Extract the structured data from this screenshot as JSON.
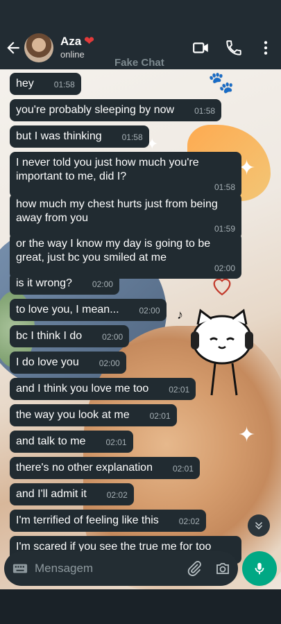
{
  "header": {
    "contact_name": "Aza",
    "contact_emoji": "❤",
    "status": "online",
    "watermark": "Fake Chat"
  },
  "messages": [
    {
      "text": "hey",
      "time": "01:58"
    },
    {
      "text": "you're probably sleeping by now",
      "time": "01:58"
    },
    {
      "text": "but I was thinking",
      "time": "01:58"
    },
    {
      "text": "I never told you just how much you're important to me, did I?",
      "time": "01:58"
    },
    {
      "text": "how much my chest hurts just from being away from you",
      "time": "01:59"
    },
    {
      "text": "or the way I know my day is going to be great, just bc you smiled at me",
      "time": "02:00"
    },
    {
      "text": "is it wrong?",
      "time": "02:00"
    },
    {
      "text": "to love you, I mean...",
      "time": "02:00"
    },
    {
      "text": "bc I think I do",
      "time": "02:00"
    },
    {
      "text": "I do love you",
      "time": "02:00"
    },
    {
      "text": "and I think you love me too",
      "time": "02:01"
    },
    {
      "text": "the way you look at me",
      "time": "02:01"
    },
    {
      "text": "and talk to me",
      "time": "02:01"
    },
    {
      "text": "there's no other explanation",
      "time": "02:01"
    },
    {
      "text": "and I'll admit it",
      "time": "02:02"
    },
    {
      "text": "I'm terrified of feeling like this",
      "time": "02:02"
    },
    {
      "text": "I'm scared if you see the true me for too",
      "time": ""
    }
  ],
  "composer": {
    "placeholder": "Mensagem"
  },
  "icons": {
    "back": "arrow-left-icon",
    "video": "video-camera-icon",
    "call": "phone-icon",
    "menu": "more-vertical-icon",
    "keyboard": "keyboard-icon",
    "attach": "paperclip-icon",
    "camera": "camera-icon",
    "mic": "microphone-icon",
    "scroll": "chevron-double-down-icon"
  },
  "colors": {
    "header_bg": "#222c33",
    "bubble_bg": "#212b31",
    "accent": "#00a884"
  }
}
